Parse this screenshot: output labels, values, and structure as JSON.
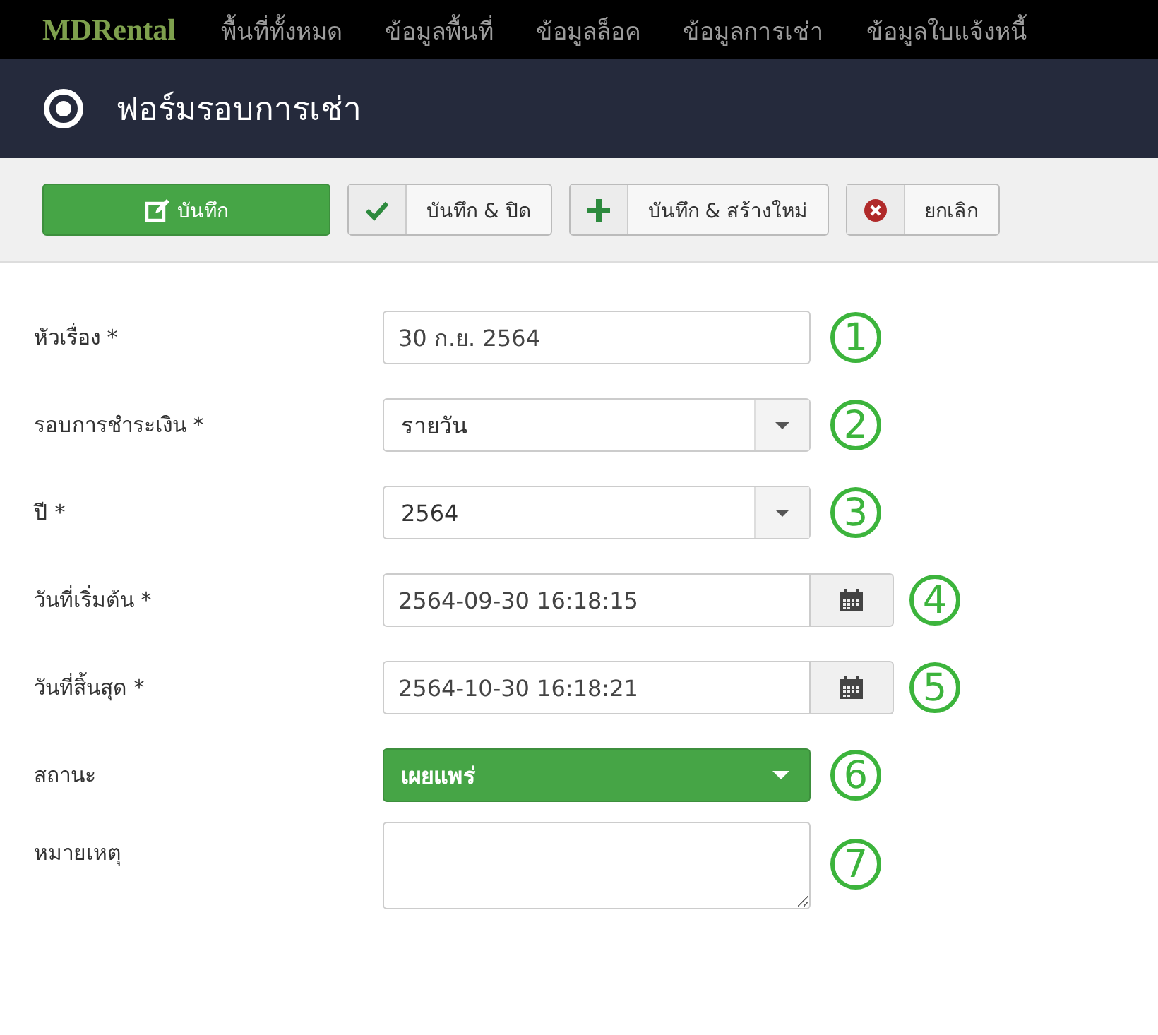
{
  "navbar": {
    "brand": "MDRental",
    "items": [
      "พื้นที่ทั้งหมด",
      "ข้อมูลพื้นที่",
      "ข้อมูลล็อค",
      "ข้อมูลการเช่า",
      "ข้อมูลใบแจ้งหนี้"
    ]
  },
  "header": {
    "title": "ฟอร์มรอบการเช่า"
  },
  "toolbar": [
    {
      "kind": "primary",
      "label": "บันทึก"
    },
    {
      "kind": "check",
      "label": "บันทึก & ปิด"
    },
    {
      "kind": "plus",
      "label": "บันทึก & สร้างใหม่"
    },
    {
      "kind": "cancel",
      "label": "ยกเลิก"
    }
  ],
  "fields": [
    {
      "kind": "text",
      "label": "หัวเรื่อง *",
      "value": "30 ก.ย. 2564",
      "marker": "1"
    },
    {
      "kind": "select",
      "label": "รอบการชำระเงิน *",
      "value": "รายวัน",
      "marker": "2"
    },
    {
      "kind": "select",
      "label": "ปี *",
      "value": "2564",
      "marker": "3"
    },
    {
      "kind": "date",
      "label": "วันที่เริ่มต้น *",
      "value": "2564-09-30 16:18:15",
      "marker": "4"
    },
    {
      "kind": "date",
      "label": "วันที่สิ้นสุด *",
      "value": "2564-10-30 16:18:21",
      "marker": "5"
    },
    {
      "kind": "status",
      "label": "สถานะ",
      "value": "เผยแพร่",
      "marker": "6"
    },
    {
      "kind": "textarea",
      "label": "หมายเหตุ",
      "marker": "7"
    }
  ]
}
